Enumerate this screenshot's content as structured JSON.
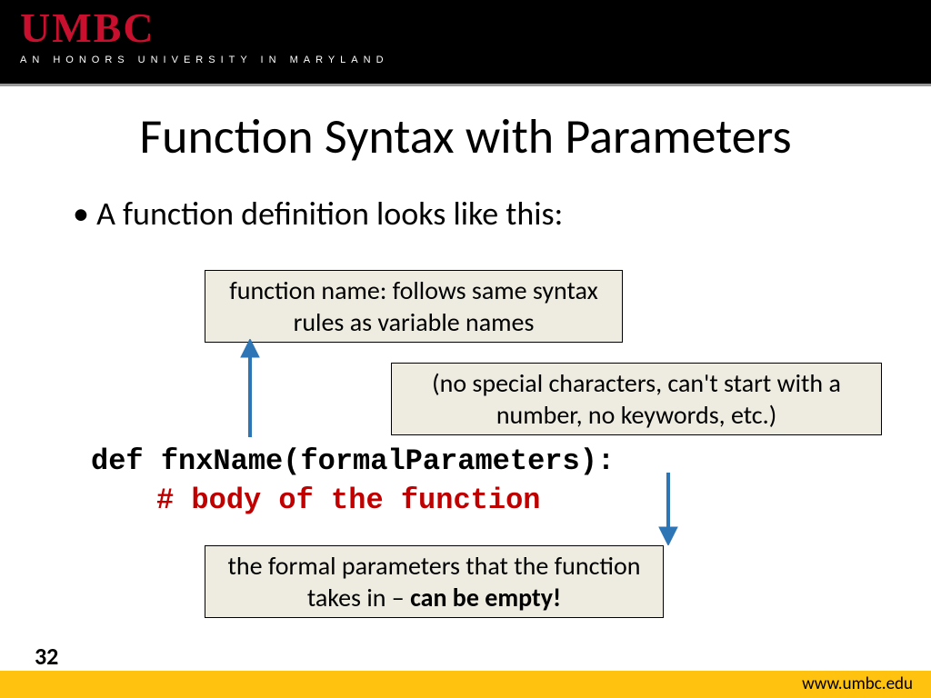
{
  "header": {
    "logo": "UMBC",
    "tagline": "AN HONORS UNIVERSITY IN MARYLAND"
  },
  "title": "Function Syntax with Parameters",
  "bullet1": "A function definition looks like this:",
  "callout1": "function name: follows same syntax rules as variable names",
  "callout2": "(no special characters, can't start with a number, no keywords, etc.)",
  "callout3_prefix": "the formal parameters that the function takes in – ",
  "callout3_bold": "can be empty!",
  "code_line1": "def fnxName(formalParameters):",
  "code_line2": "# body of the function",
  "page_number": "32",
  "url": "www.umbc.edu"
}
